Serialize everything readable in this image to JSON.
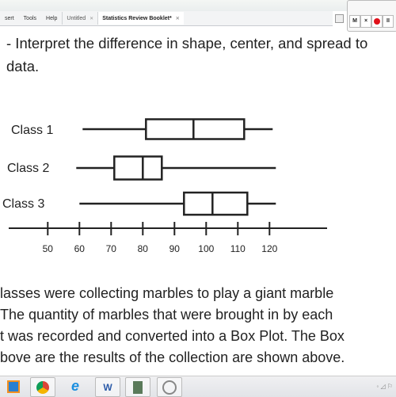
{
  "menubar": {
    "menus": [
      "sert",
      "Tools",
      "Help"
    ],
    "tabs": [
      {
        "label": "Untitled",
        "active": false
      },
      {
        "label": "Statistics Review Booklet*",
        "active": true
      }
    ]
  },
  "recorder": {
    "buttons": [
      "M",
      "×",
      "record",
      "II"
    ],
    "record_color": "#e0101a"
  },
  "heading": {
    "line1": "- Interpret the difference in shape, center, and spread to",
    "line2": "data."
  },
  "chart_data": {
    "type": "boxplot",
    "categories": [
      "Class 1",
      "Class 2",
      "Class 3"
    ],
    "series": [
      {
        "name": "Class 1",
        "min": 61,
        "q1": 81,
        "median": 96,
        "q3": 112,
        "max": 121
      },
      {
        "name": "Class 2",
        "min": 59,
        "q1": 71,
        "median": 80,
        "q3": 86,
        "max": 122
      },
      {
        "name": "Class 3",
        "min": 60,
        "q1": 93,
        "median": 102,
        "q3": 113,
        "max": 122
      }
    ],
    "x_ticks": [
      50,
      60,
      70,
      80,
      90,
      100,
      110,
      120
    ],
    "xlim": [
      38,
      138
    ],
    "grid": false
  },
  "paragraph": [
    "lasses were collecting marbles to play a giant marble",
    "The quantity of marbles that were brought in by each",
    "t was recorded and converted into a Box Plot.  The Box",
    "bove are the results of the collection are shown above."
  ],
  "taskbar": {
    "apps": [
      "media-player",
      "chrome",
      "internet-explorer",
      "word",
      "recorder-app",
      "paint-app"
    ],
    "word_label": "W"
  }
}
